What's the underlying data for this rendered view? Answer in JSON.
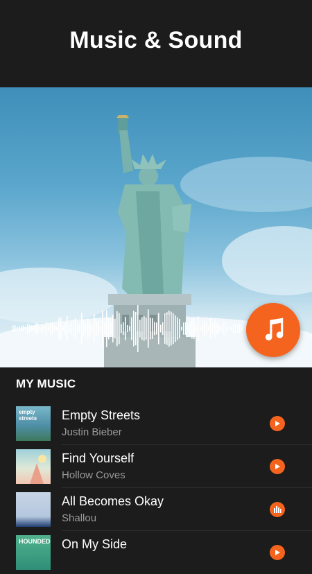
{
  "header": {
    "title": "Music & Sound"
  },
  "hero": {
    "image": "statue-of-liberty-photo",
    "fab_icon": "music-note-icon",
    "accent": "#f5641e"
  },
  "section": {
    "title": "MY MUSIC"
  },
  "tracks": [
    {
      "title": "Empty Streets",
      "artist": "Justin Bieber",
      "thumb_text": "empty streets",
      "action_icon": "play-icon"
    },
    {
      "title": "Find Yourself",
      "artist": "Hollow  Coves",
      "thumb_text": "",
      "action_icon": "play-icon"
    },
    {
      "title": "All Becomes Okay",
      "artist": "Shallou",
      "thumb_text": "",
      "action_icon": "equalizer-icon"
    },
    {
      "title": "On My Side",
      "artist": "",
      "thumb_text": "HOUNDED",
      "action_icon": "play-icon"
    }
  ]
}
